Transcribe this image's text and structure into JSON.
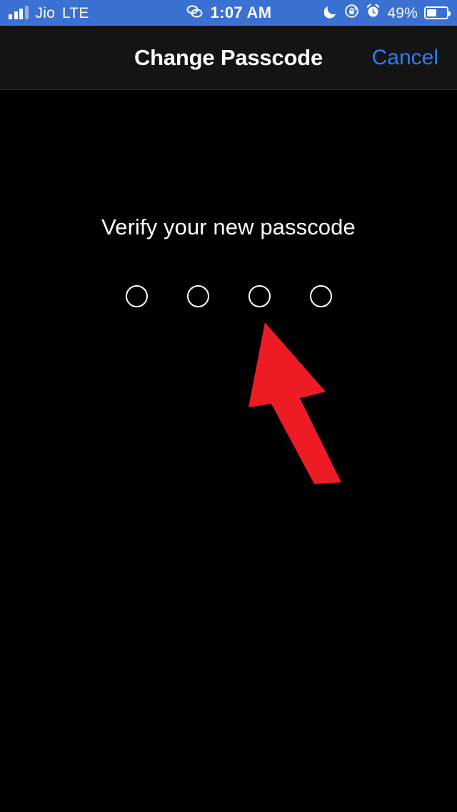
{
  "status_bar": {
    "carrier": "Jio",
    "network": "LTE",
    "time": "1:07 AM",
    "battery_percent_label": "49%",
    "battery_percent": 49,
    "signal_bars_total": 4,
    "signal_bars_active": 3,
    "background_color": "#3a71d2",
    "icons": {
      "signal": "signal-bars-icon",
      "link": "chain-link-icon",
      "moon": "do-not-disturb-moon-icon",
      "rotation_lock": "rotation-lock-icon",
      "alarm": "alarm-clock-icon",
      "battery": "battery-icon"
    }
  },
  "nav_bar": {
    "title": "Change Passcode",
    "cancel_label": "Cancel",
    "cancel_color": "#2f7cf6",
    "background_color": "#141414"
  },
  "main": {
    "prompt": "Verify your new passcode",
    "passcode": {
      "length": 4,
      "entered": 0,
      "dots": [
        {
          "filled": false
        },
        {
          "filled": false
        },
        {
          "filled": false
        },
        {
          "filled": false
        }
      ]
    }
  },
  "annotation": {
    "arrow": {
      "name": "red-arrow-annotation",
      "color": "#ed1c24",
      "points_to": "passcode-dot-3",
      "direction": "up-left"
    }
  }
}
